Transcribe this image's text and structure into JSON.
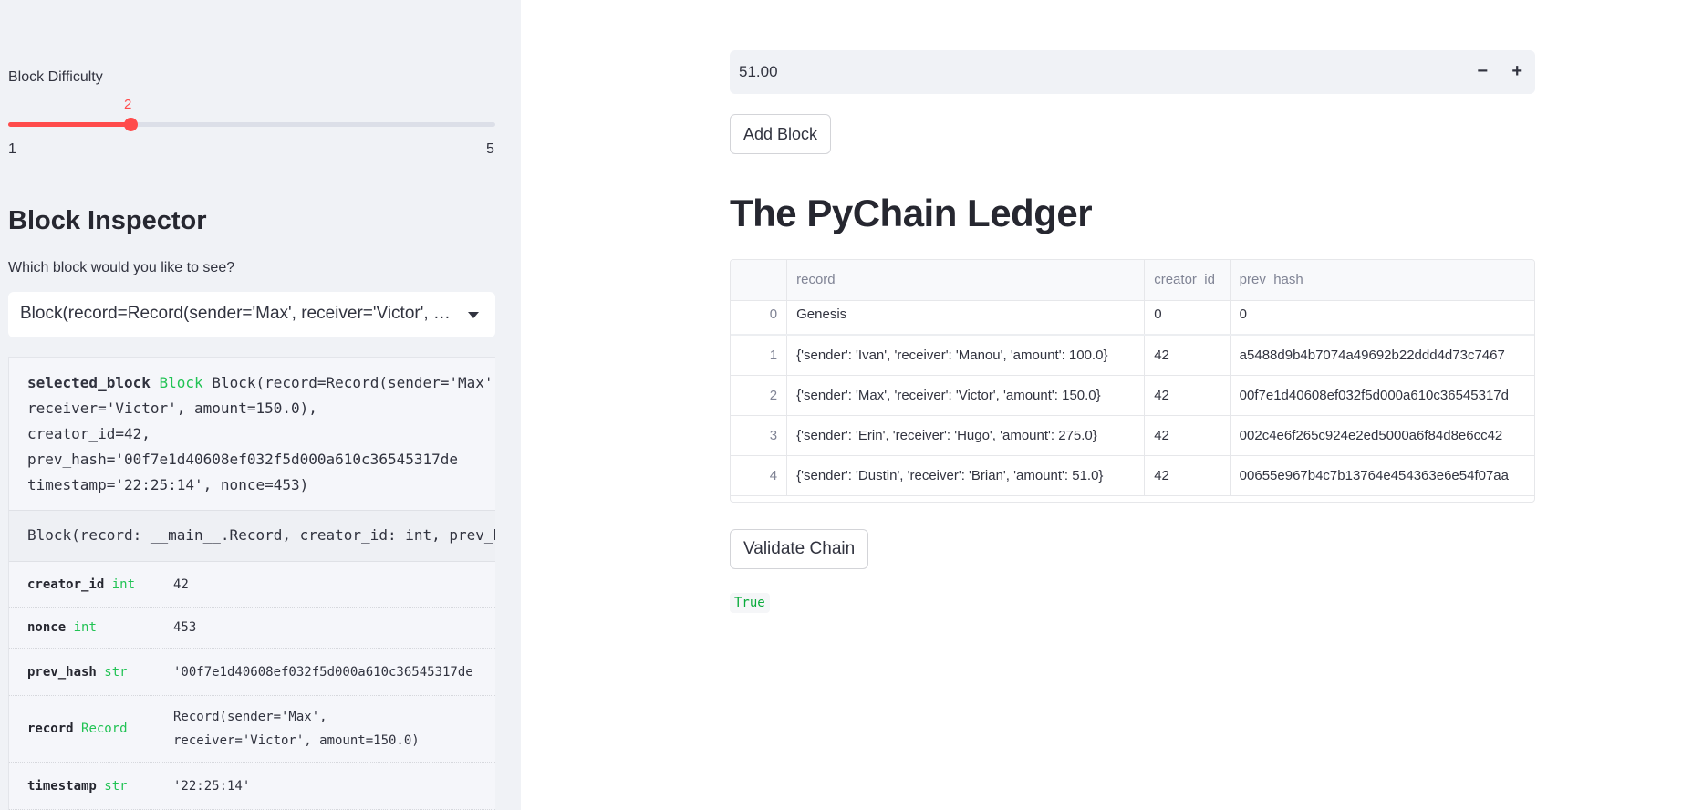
{
  "sidebar": {
    "difficulty": {
      "label": "Block Difficulty",
      "value": 2,
      "value_text": "2",
      "min": "1",
      "max": "5",
      "accent": "#ff4b4b"
    },
    "inspector": {
      "heading": "Block Inspector",
      "prompt": "Which block would you like to see?",
      "selected": "Block(record=Record(sender='Max', receiver='Victor', …",
      "code": {
        "name": "selected_block",
        "type": "Block",
        "lines": [
          " Block(record=Record(sender='Max',",
          "receiver='Victor', amount=150.0),",
          "creator_id=42,",
          "prev_hash='00f7e1d40608ef032f5d000a610c36545317de",
          "timestamp='22:25:14', nonce=453)"
        ]
      },
      "signature": "Block(record: __main__.Record, creator_id: int, prev_hash: str, timestamp: str, nonce: int)",
      "attributes": [
        {
          "name": "creator_id",
          "type": "int",
          "value": "42"
        },
        {
          "name": "nonce",
          "type": "int",
          "value": "453"
        },
        {
          "name": "prev_hash",
          "type": "str",
          "value": "'00f7e1d40608ef032f5d000a610c36545317de"
        },
        {
          "name": "record",
          "type": "Record",
          "value": "Record(sender='Max',\nreceiver='Victor', amount=150.0)"
        },
        {
          "name": "timestamp",
          "type": "str",
          "value": "'22:25:14'"
        }
      ]
    }
  },
  "main": {
    "amount_input": "51.00",
    "minus": "−",
    "plus": "+",
    "add_block": "Add Block",
    "title": "The PyChain Ledger",
    "table": {
      "columns": [
        "",
        "record",
        "creator_id",
        "prev_hash"
      ],
      "rows": [
        [
          "0",
          "Genesis",
          "0",
          "0"
        ],
        [
          "1",
          "{'sender': 'Ivan', 'receiver': 'Manou', 'amount': 100.0}",
          "42",
          "a5488d9b4b7074a49692b22ddd4d73c7467"
        ],
        [
          "2",
          "{'sender': 'Max', 'receiver': 'Victor', 'amount': 150.0}",
          "42",
          "00f7e1d40608ef032f5d000a610c36545317d"
        ],
        [
          "3",
          "{'sender': 'Erin', 'receiver': 'Hugo', 'amount': 275.0}",
          "42",
          "002c4e6f265c924e2ed5000a6f84d8e6cc42"
        ],
        [
          "4",
          "{'sender': 'Dustin', 'receiver': 'Brian', 'amount': 51.0}",
          "42",
          "00655e967b4c7b13764e454363e6e54f07aa"
        ]
      ]
    },
    "validate": "Validate Chain",
    "validation_result": "True"
  }
}
